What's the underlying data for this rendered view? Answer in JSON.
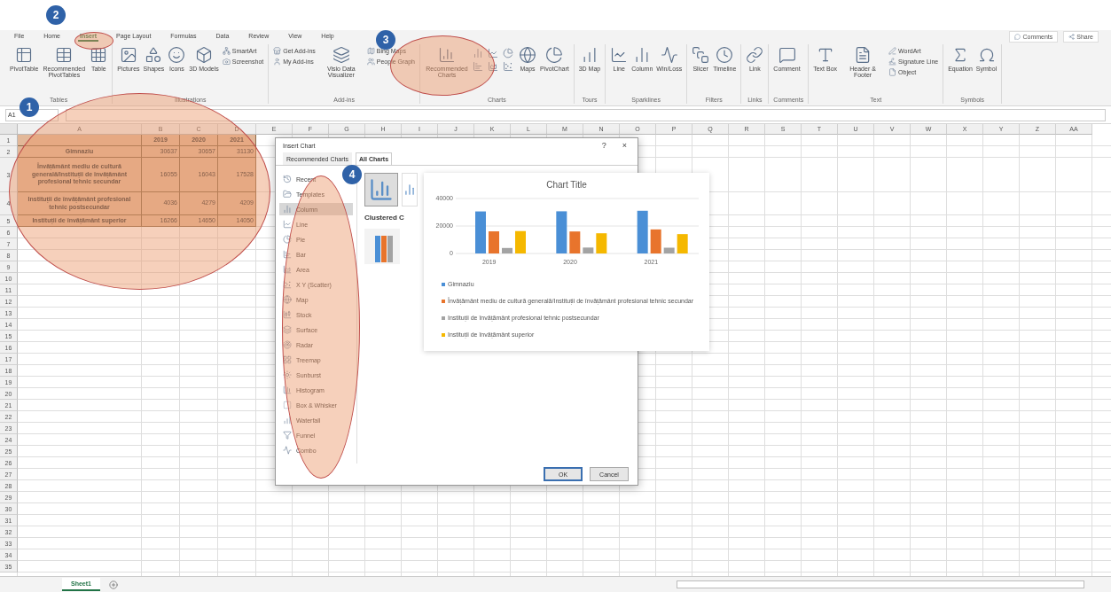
{
  "ribbon": {
    "tabs": [
      {
        "label": "File",
        "selected": false
      },
      {
        "label": "Home",
        "selected": false
      },
      {
        "label": "Insert",
        "selected": true
      },
      {
        "label": "Page Layout",
        "selected": false
      },
      {
        "label": "Formulas",
        "selected": false
      },
      {
        "label": "Data",
        "selected": false
      },
      {
        "label": "Review",
        "selected": false
      },
      {
        "label": "View",
        "selected": false
      },
      {
        "label": "Help",
        "selected": false
      }
    ],
    "right_buttons": [
      "Comments",
      "Share"
    ],
    "groups": [
      {
        "label": "Tables",
        "items": [
          {
            "kind": "large",
            "label": "PivotTable"
          },
          {
            "kind": "large",
            "label": "Recommended PivotTables"
          },
          {
            "kind": "large",
            "label": "Table"
          }
        ]
      },
      {
        "label": "Illustrations",
        "items": [
          {
            "kind": "large",
            "label": "Pictures"
          },
          {
            "kind": "large",
            "label": "Shapes"
          },
          {
            "kind": "large",
            "label": "Icons"
          },
          {
            "kind": "large",
            "label": "3D Models"
          },
          {
            "kind": "small",
            "label": "SmartArt"
          },
          {
            "kind": "small",
            "label": "Screenshot"
          }
        ]
      },
      {
        "label": "Add-ins",
        "items": [
          {
            "kind": "small",
            "label": "Get Add-ins"
          },
          {
            "kind": "small",
            "label": "My Add-ins"
          },
          {
            "kind": "large",
            "label": "Visio Data Visualizer"
          },
          {
            "kind": "small",
            "label": "Bing Maps"
          },
          {
            "kind": "small",
            "label": "People Graph"
          }
        ]
      },
      {
        "label": "Charts",
        "items": [
          {
            "kind": "large",
            "label": "Recommended Charts"
          },
          {
            "kind": "icon_grid"
          },
          {
            "kind": "large",
            "label": "Maps"
          },
          {
            "kind": "large",
            "label": "PivotChart"
          }
        ]
      },
      {
        "label": "Tours",
        "items": [
          {
            "kind": "large",
            "label": "3D Map"
          }
        ]
      },
      {
        "label": "Sparklines",
        "items": [
          {
            "kind": "large",
            "label": "Line"
          },
          {
            "kind": "large",
            "label": "Column"
          },
          {
            "kind": "large",
            "label": "Win/Loss"
          }
        ]
      },
      {
        "label": "Filters",
        "items": [
          {
            "kind": "large",
            "label": "Slicer"
          },
          {
            "kind": "large",
            "label": "Timeline"
          }
        ]
      },
      {
        "label": "Links",
        "items": [
          {
            "kind": "large",
            "label": "Link"
          }
        ]
      },
      {
        "label": "Comments",
        "items": [
          {
            "kind": "large",
            "label": "Comment"
          }
        ]
      },
      {
        "label": "Text",
        "items": [
          {
            "kind": "large",
            "label": "Text Box"
          },
          {
            "kind": "large",
            "label": "Header & Footer"
          },
          {
            "kind": "small",
            "label": "WordArt"
          },
          {
            "kind": "small",
            "label": "Signature Line"
          },
          {
            "kind": "small",
            "label": "Object"
          }
        ]
      },
      {
        "label": "Symbols",
        "items": [
          {
            "kind": "large",
            "label": "Equation"
          },
          {
            "kind": "large",
            "label": "Symbol"
          }
        ]
      }
    ]
  },
  "formula_bar": {
    "name_box": "A1"
  },
  "sheet": {
    "columns": [
      "A",
      "B",
      "C",
      "D",
      "E",
      "F",
      "G",
      "H",
      "I",
      "J",
      "K",
      "L",
      "M",
      "N",
      "O",
      "P",
      "Q",
      "R",
      "S",
      "T",
      "U",
      "V",
      "W",
      "X",
      "Y",
      "Z",
      "AA"
    ],
    "row_numbers": [
      "1",
      "2",
      "3",
      "4",
      "5",
      "6",
      "7",
      "8",
      "9",
      "10",
      "11",
      "12",
      "13",
      "14",
      "15",
      "16",
      "17",
      "18",
      "19",
      "20",
      "21",
      "22",
      "23",
      "24",
      "25",
      "26",
      "27",
      "28",
      "29",
      "30",
      "31",
      "32",
      "33",
      "34",
      "35"
    ],
    "header": [
      "2019",
      "2020",
      "2021"
    ],
    "rows": [
      {
        "label": "Gimnaziu",
        "values": [
          "30637",
          "30657",
          "31130"
        ]
      },
      {
        "label": "Învățământ mediu de cultură generală/Instituții de învățământ profesional tehnic secundar",
        "values": [
          "16055",
          "16043",
          "17528"
        ]
      },
      {
        "label": "Instituții de învățământ profesional tehnic postsecundar",
        "values": [
          "4036",
          "4279",
          "4209"
        ]
      },
      {
        "label": "Instituții de învățământ superior",
        "values": [
          "16266",
          "14650",
          "14050"
        ]
      }
    ],
    "tabs": [
      {
        "label": "Sheet1",
        "selected": true
      }
    ]
  },
  "dialog": {
    "title": "Insert Chart",
    "help": "?",
    "close": "×",
    "tabs": [
      {
        "label": "Recommended Charts",
        "selected": false
      },
      {
        "label": "All Charts",
        "selected": true
      }
    ],
    "chart_types": [
      {
        "label": "Recent",
        "selected": false
      },
      {
        "label": "Templates",
        "selected": false
      },
      {
        "label": "Column",
        "selected": true
      },
      {
        "label": "Line",
        "selected": false
      },
      {
        "label": "Pie",
        "selected": false
      },
      {
        "label": "Bar",
        "selected": false
      },
      {
        "label": "Area",
        "selected": false
      },
      {
        "label": "X Y (Scatter)",
        "selected": false
      },
      {
        "label": "Map",
        "selected": false
      },
      {
        "label": "Stock",
        "selected": false
      },
      {
        "label": "Surface",
        "selected": false
      },
      {
        "label": "Radar",
        "selected": false
      },
      {
        "label": "Treemap",
        "selected": false
      },
      {
        "label": "Sunburst",
        "selected": false
      },
      {
        "label": "Histogram",
        "selected": false
      },
      {
        "label": "Box & Whisker",
        "selected": false
      },
      {
        "label": "Waterfall",
        "selected": false
      },
      {
        "label": "Funnel",
        "selected": false
      },
      {
        "label": "Combo",
        "selected": false
      }
    ],
    "subtype_title": "Clustered C",
    "buttons": [
      {
        "label": "OK",
        "default": true
      },
      {
        "label": "Cancel",
        "default": false
      }
    ]
  },
  "preview": {
    "chart_data": {
      "type": "bar",
      "title": "Chart Title",
      "categories": [
        "2019",
        "2020",
        "2021"
      ],
      "ylim": [
        0,
        40000
      ],
      "yticks": [
        0,
        20000,
        40000
      ],
      "series": [
        {
          "name": "Gimnaziu",
          "color": "#4a8fd6",
          "values": [
            30600,
            30700,
            31100
          ]
        },
        {
          "name": "Învățământ mediu de cultură generală/Instituții de învățământ profesional tehnic secundar",
          "color": "#e8742c",
          "values": [
            16100,
            16000,
            17500
          ]
        },
        {
          "name": "Instituții de învățământ profesional tehnic postsecundar",
          "color": "#a3a3a3",
          "values": [
            4000,
            4300,
            4200
          ]
        },
        {
          "name": "Instituții de învățământ superior",
          "color": "#f5b800",
          "values": [
            16300,
            14700,
            14100
          ]
        }
      ]
    }
  },
  "annotations": [
    {
      "number": "1"
    },
    {
      "number": "2"
    },
    {
      "number": "3"
    },
    {
      "number": "4"
    }
  ]
}
